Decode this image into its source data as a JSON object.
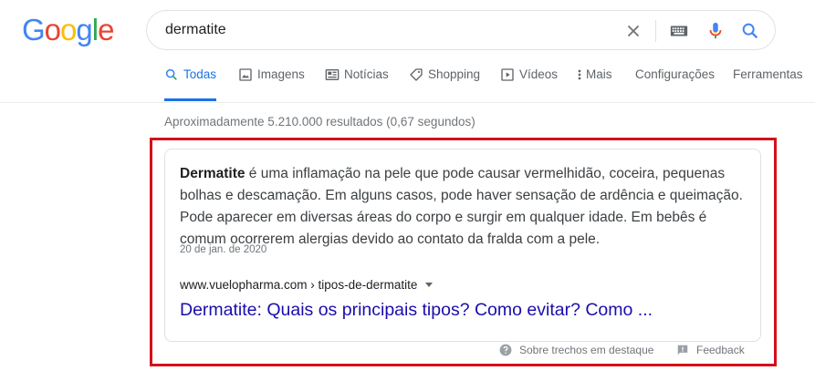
{
  "logo": {
    "letters": [
      "G",
      "o",
      "o",
      "g",
      "l",
      "e"
    ],
    "colors": [
      "#4285F4",
      "#EA4335",
      "#FBBC05",
      "#4285F4",
      "#34A853",
      "#EA4335"
    ]
  },
  "search": {
    "query": "dermatite",
    "icons": [
      "clear-icon",
      "keyboard-icon",
      "mic-icon",
      "search-icon"
    ]
  },
  "tabs": [
    {
      "label": "Todas",
      "icon": "search-icon",
      "active": true
    },
    {
      "label": "Imagens",
      "icon": "image-icon"
    },
    {
      "label": "Notícias",
      "icon": "news-icon"
    },
    {
      "label": "Shopping",
      "icon": "tag-icon"
    },
    {
      "label": "Vídeos",
      "icon": "play-icon"
    },
    {
      "label": "Mais",
      "icon": "more-vert-icon"
    },
    {
      "label": "Configurações"
    },
    {
      "label": "Ferramentas"
    }
  ],
  "stats": "Aproximadamente 5.210.000 resultados (0,67 segundos)",
  "snippet": {
    "bold": "Dermatite",
    "text": " é uma inflamação na pele que pode causar vermelhidão, coceira, pequenas bolhas e descamação. Em alguns casos, pode haver sensação de ardência e queimação. Pode aparecer em diversas áreas do corpo e surgir em qualquer idade. Em bebês é comum ocorrerem alergias devido ao contato da fralda com a pele.",
    "date": "20 de jan. de 2020",
    "cite": "www.vuelopharma.com › tipos-de-dermatite",
    "title": "Dermatite: Quais os principais tipos? Como evitar? Como ...",
    "about": "Sobre trechos em destaque",
    "feedback": "Feedback"
  },
  "colors": {
    "accent": "#1a73e8",
    "link": "#1a0dab",
    "highlight": "#d4111b"
  }
}
